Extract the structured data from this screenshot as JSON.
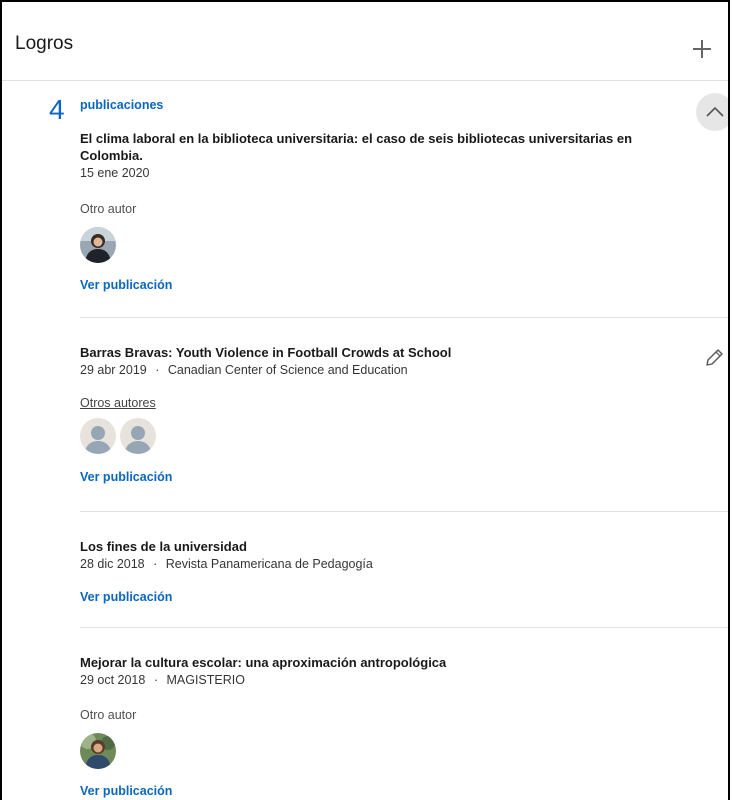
{
  "section": {
    "title": "Logros",
    "count": "4",
    "category": "publicaciones"
  },
  "publications": [
    {
      "title": "El clima laboral en la biblioteca universitaria: el caso de seis bibliotecas universitarias en Colombia.",
      "date": "15 ene 2020",
      "authors_label": "Otro autor",
      "link_label": "Ver publicación"
    },
    {
      "title": "Barras Bravas: Youth Violence in Football Crowds at School",
      "date": "29 abr 2019",
      "separator": "·",
      "publisher": "Canadian Center of Science and Education",
      "authors_label": "Otros autores",
      "link_label": "Ver publicación"
    },
    {
      "title": "Los fines de la universidad",
      "date": "28 dic 2018",
      "separator": "·",
      "publisher": "Revista Panamericana de Pedagogía",
      "link_label": "Ver publicación"
    },
    {
      "title": "Mejorar la cultura escolar: una aproximación antropológica",
      "date": "29 oct 2018",
      "separator": "·",
      "publisher": "MAGISTERIO",
      "authors_label": "Otro autor",
      "link_label": "Ver publicación"
    }
  ],
  "icons": {
    "add": "plus-icon",
    "collapse": "chevron-up-icon",
    "edit": "pencil-icon"
  },
  "colors": {
    "accent": "#0a66c2",
    "divider": "#e0e0e0",
    "collapse_bg": "#e6e6e6"
  }
}
